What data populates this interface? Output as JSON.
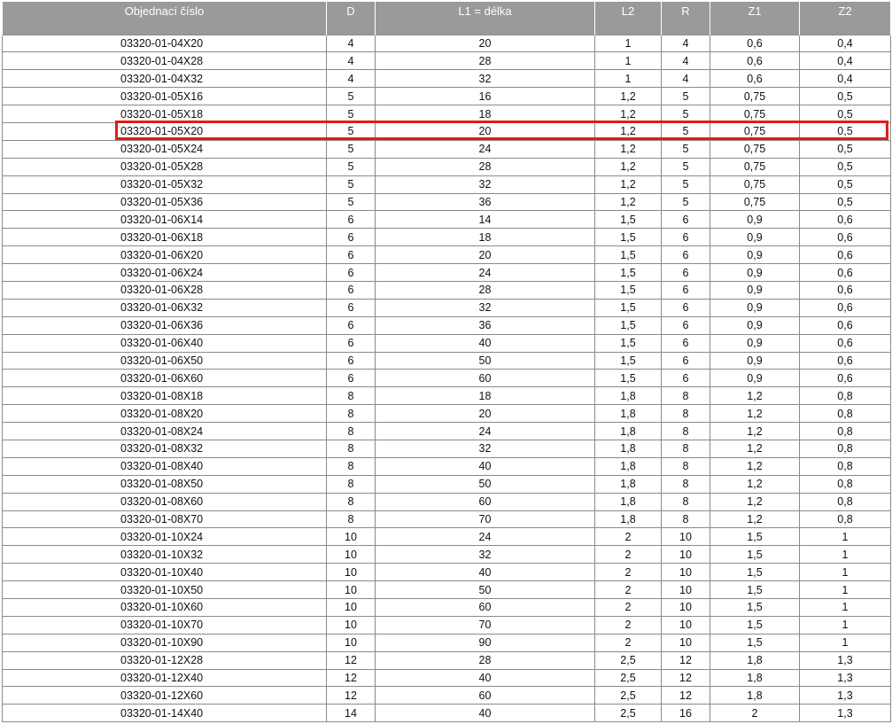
{
  "table": {
    "headers": [
      "Objednací číslo",
      "D",
      "L1 = délka",
      "L2",
      "R",
      "Z1",
      "Z2"
    ],
    "highlighted_code": "03320-01-05X20",
    "highlight_color": "#e31b1b",
    "rows": [
      [
        "03320-01-04X20",
        "4",
        "20",
        "1",
        "4",
        "0,6",
        "0,4"
      ],
      [
        "03320-01-04X28",
        "4",
        "28",
        "1",
        "4",
        "0,6",
        "0,4"
      ],
      [
        "03320-01-04X32",
        "4",
        "32",
        "1",
        "4",
        "0,6",
        "0,4"
      ],
      [
        "03320-01-05X16",
        "5",
        "16",
        "1,2",
        "5",
        "0,75",
        "0,5"
      ],
      [
        "03320-01-05X18",
        "5",
        "18",
        "1,2",
        "5",
        "0,75",
        "0,5"
      ],
      [
        "03320-01-05X20",
        "5",
        "20",
        "1,2",
        "5",
        "0,75",
        "0,5"
      ],
      [
        "03320-01-05X24",
        "5",
        "24",
        "1,2",
        "5",
        "0,75",
        "0,5"
      ],
      [
        "03320-01-05X28",
        "5",
        "28",
        "1,2",
        "5",
        "0,75",
        "0,5"
      ],
      [
        "03320-01-05X32",
        "5",
        "32",
        "1,2",
        "5",
        "0,75",
        "0,5"
      ],
      [
        "03320-01-05X36",
        "5",
        "36",
        "1,2",
        "5",
        "0,75",
        "0,5"
      ],
      [
        "03320-01-06X14",
        "6",
        "14",
        "1,5",
        "6",
        "0,9",
        "0,6"
      ],
      [
        "03320-01-06X18",
        "6",
        "18",
        "1,5",
        "6",
        "0,9",
        "0,6"
      ],
      [
        "03320-01-06X20",
        "6",
        "20",
        "1,5",
        "6",
        "0,9",
        "0,6"
      ],
      [
        "03320-01-06X24",
        "6",
        "24",
        "1,5",
        "6",
        "0,9",
        "0,6"
      ],
      [
        "03320-01-06X28",
        "6",
        "28",
        "1,5",
        "6",
        "0,9",
        "0,6"
      ],
      [
        "03320-01-06X32",
        "6",
        "32",
        "1,5",
        "6",
        "0,9",
        "0,6"
      ],
      [
        "03320-01-06X36",
        "6",
        "36",
        "1,5",
        "6",
        "0,9",
        "0,6"
      ],
      [
        "03320-01-06X40",
        "6",
        "40",
        "1,5",
        "6",
        "0,9",
        "0,6"
      ],
      [
        "03320-01-06X50",
        "6",
        "50",
        "1,5",
        "6",
        "0,9",
        "0,6"
      ],
      [
        "03320-01-06X60",
        "6",
        "60",
        "1,5",
        "6",
        "0,9",
        "0,6"
      ],
      [
        "03320-01-08X18",
        "8",
        "18",
        "1,8",
        "8",
        "1,2",
        "0,8"
      ],
      [
        "03320-01-08X20",
        "8",
        "20",
        "1,8",
        "8",
        "1,2",
        "0,8"
      ],
      [
        "03320-01-08X24",
        "8",
        "24",
        "1,8",
        "8",
        "1,2",
        "0,8"
      ],
      [
        "03320-01-08X32",
        "8",
        "32",
        "1,8",
        "8",
        "1,2",
        "0,8"
      ],
      [
        "03320-01-08X40",
        "8",
        "40",
        "1,8",
        "8",
        "1,2",
        "0,8"
      ],
      [
        "03320-01-08X50",
        "8",
        "50",
        "1,8",
        "8",
        "1,2",
        "0,8"
      ],
      [
        "03320-01-08X60",
        "8",
        "60",
        "1,8",
        "8",
        "1,2",
        "0,8"
      ],
      [
        "03320-01-08X70",
        "8",
        "70",
        "1,8",
        "8",
        "1,2",
        "0,8"
      ],
      [
        "03320-01-10X24",
        "10",
        "24",
        "2",
        "10",
        "1,5",
        "1"
      ],
      [
        "03320-01-10X32",
        "10",
        "32",
        "2",
        "10",
        "1,5",
        "1"
      ],
      [
        "03320-01-10X40",
        "10",
        "40",
        "2",
        "10",
        "1,5",
        "1"
      ],
      [
        "03320-01-10X50",
        "10",
        "50",
        "2",
        "10",
        "1,5",
        "1"
      ],
      [
        "03320-01-10X60",
        "10",
        "60",
        "2",
        "10",
        "1,5",
        "1"
      ],
      [
        "03320-01-10X70",
        "10",
        "70",
        "2",
        "10",
        "1,5",
        "1"
      ],
      [
        "03320-01-10X90",
        "10",
        "90",
        "2",
        "10",
        "1,5",
        "1"
      ],
      [
        "03320-01-12X28",
        "12",
        "28",
        "2,5",
        "12",
        "1,8",
        "1,3"
      ],
      [
        "03320-01-12X40",
        "12",
        "40",
        "2,5",
        "12",
        "1,8",
        "1,3"
      ],
      [
        "03320-01-12X60",
        "12",
        "60",
        "2,5",
        "12",
        "1,8",
        "1,3"
      ],
      [
        "03320-01-14X40",
        "14",
        "40",
        "2,5",
        "16",
        "2",
        "1,3"
      ]
    ]
  }
}
